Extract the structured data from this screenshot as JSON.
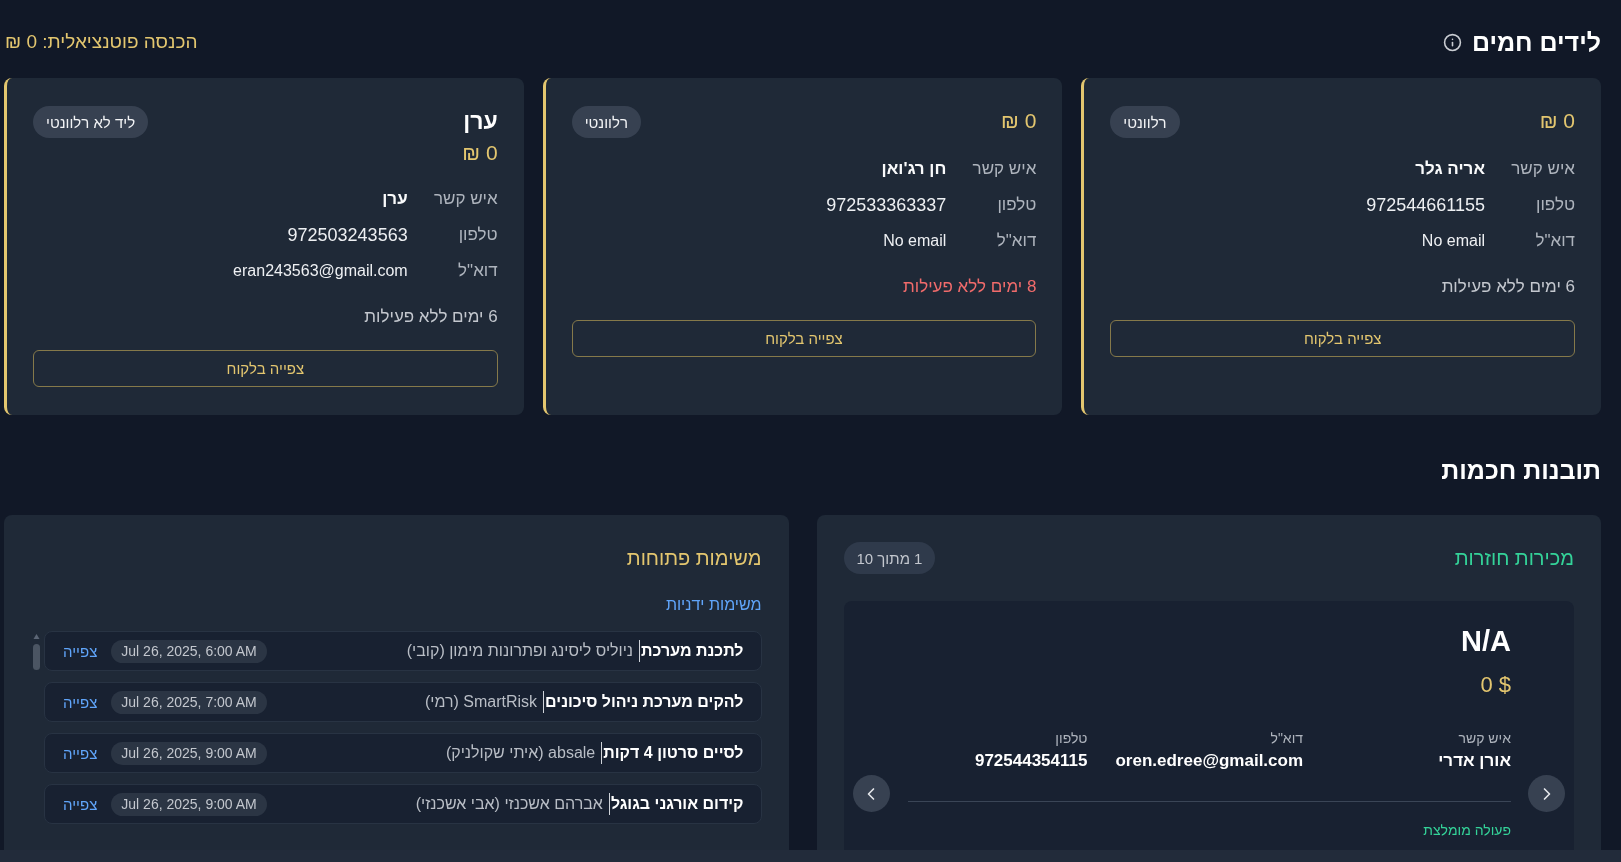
{
  "hot_leads": {
    "title": "לידים חמים",
    "potential_income": "הכנסה פוטנציאלית: 0 ₪",
    "cards": [
      {
        "amount": "0 ₪",
        "badge": "רלוונטי",
        "fields": [
          {
            "kind": "contact",
            "label": "איש קשר",
            "value": "אריה גלר"
          },
          {
            "kind": "phone",
            "label": "טלפון",
            "value": "972544661155"
          },
          {
            "kind": "email",
            "label": "דוא\"ל",
            "value": "No email"
          }
        ],
        "inactivity": "6 ימים ללא פעילות",
        "inactivity_alert": false,
        "button": "צפייה בלקוח"
      },
      {
        "amount": "0 ₪",
        "badge": "רלוונטי",
        "fields": [
          {
            "kind": "contact",
            "label": "איש קשר",
            "value": "חן רג'ואן"
          },
          {
            "kind": "phone",
            "label": "טלפון",
            "value": "972533363337"
          },
          {
            "kind": "email",
            "label": "דוא\"ל",
            "value": "No email"
          }
        ],
        "inactivity": "8 ימים ללא פעילות",
        "inactivity_alert": true,
        "button": "צפייה בלקוח"
      },
      {
        "name": "ערן",
        "amount": "0 ₪",
        "badge": "ליד לא רלוונטי",
        "fields": [
          {
            "kind": "contact",
            "label": "איש קשר",
            "value": "ערן"
          },
          {
            "kind": "phone",
            "label": "טלפון",
            "value": "972503243563"
          },
          {
            "kind": "email",
            "label": "דוא\"ל",
            "value": "eran243563@gmail.com"
          }
        ],
        "inactivity": "6 ימים ללא פעילות",
        "inactivity_alert": false,
        "button": "צפייה בלקוח"
      }
    ]
  },
  "smart_insights": {
    "title": "תובנות חכמות",
    "repeat_sales": {
      "title": "מכירות חוזרות",
      "counter": "1 מתוך 10",
      "customer": {
        "name": "N/A",
        "amount": "0 $",
        "fields": [
          {
            "label": "איש קשר",
            "value": "אורן אדרי"
          },
          {
            "label": "דוא\"ל",
            "value": "oren.edree@gmail.com"
          },
          {
            "label": "טלפון",
            "value": "972544354115"
          }
        ],
        "recommended_action_label": "פעולה מומלצת"
      }
    },
    "open_tasks": {
      "title": "משימות פתוחות",
      "filter_link": "משימות ידניות",
      "tasks": [
        {
          "title": "לתכנת מערכת",
          "client": "ניוליס ליסינג ופתרונות מימון (קובי)",
          "due": "Jul 26, 2025, 6:00 AM",
          "action": "צפייה"
        },
        {
          "title": "להקים מערכת ניהול סיכונים",
          "client": "SmartRisk (רמי)",
          "due": "Jul 26, 2025, 7:00 AM",
          "action": "צפייה"
        },
        {
          "title": "לסיים סרטון 4 דקות",
          "client": "absale (איתי שקולניק)",
          "due": "Jul 26, 2025, 9:00 AM",
          "action": "צפייה"
        },
        {
          "title": "קידום אורגני בגוגל",
          "client": "אברהם אשכנזי (אבי אשכנזי)",
          "due": "Jul 26, 2025, 9:00 AM",
          "action": "צפייה"
        }
      ]
    }
  }
}
